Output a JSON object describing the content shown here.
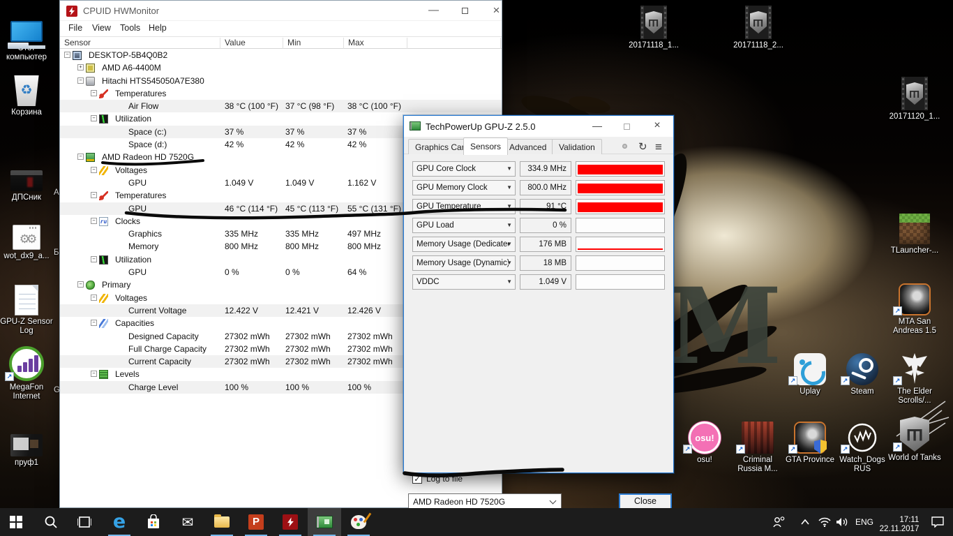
{
  "desktop_icons": [
    {
      "id": "this-pc",
      "label": "Этот компьютер"
    },
    {
      "id": "recycle-bin",
      "label": "Корзина"
    },
    {
      "id": "dpsnik",
      "label": "ДПСник"
    },
    {
      "id": "wot-dx9",
      "label": "wot_dx9_a..."
    },
    {
      "id": "gpuz-sensor-log",
      "label": "GPU-Z Sensor Log"
    },
    {
      "id": "megafon-internet",
      "label": "MegaFon Internet"
    },
    {
      "id": "pruf1",
      "label": "пруф1"
    },
    {
      "id": "replay-20171118-1",
      "label": "20171118_1..."
    },
    {
      "id": "replay-20171118-2",
      "label": "20171118_2..."
    },
    {
      "id": "replay-20171120-1",
      "label": "20171120_1..."
    },
    {
      "id": "tlauncher",
      "label": "TLauncher-..."
    },
    {
      "id": "mta-san-andreas",
      "label": "MTA San Andreas 1.5"
    },
    {
      "id": "uplay",
      "label": "Uplay"
    },
    {
      "id": "steam",
      "label": "Steam"
    },
    {
      "id": "elder-scrolls",
      "label": "The Elder Scrolls/..."
    },
    {
      "id": "osu",
      "label": "osu!"
    },
    {
      "id": "criminal-russia",
      "label": "Criminal Russia M..."
    },
    {
      "id": "gta-province",
      "label": "GTA Province"
    },
    {
      "id": "watch-dogs-rus",
      "label": "Watch_Dogs RUS"
    },
    {
      "id": "world-of-tanks",
      "label": "World of Tanks"
    }
  ],
  "hidden_label_fragments": [
    "А",
    "Б",
    "G"
  ],
  "hwmonitor": {
    "title": "CPUID HWMonitor",
    "menu": [
      "File",
      "View",
      "Tools",
      "Help"
    ],
    "columns": [
      "Sensor",
      "Value",
      "Min",
      "Max"
    ],
    "window_controls": {
      "minimize": "—",
      "close": "×"
    },
    "rows": [
      {
        "label": "DESKTOP-5B4Q0B2",
        "level": 0,
        "icon": "computer",
        "expand": "minus"
      },
      {
        "label": "AMD A6-4400M",
        "level": 1,
        "icon": "chip",
        "expand": "plus"
      },
      {
        "label": "Hitachi HTS545050A7E380",
        "level": 1,
        "icon": "disk",
        "expand": "minus"
      },
      {
        "label": "Temperatures",
        "level": 2,
        "icon": "thermo",
        "expand": "minus"
      },
      {
        "label": "Air Flow",
        "level": 3,
        "value": "38 °C  (100 °F)",
        "min": "37 °C  (98 °F)",
        "max": "38 °C  (100 °F)",
        "shaded": true
      },
      {
        "label": "Utilization",
        "level": 2,
        "icon": "util",
        "expand": "minus"
      },
      {
        "label": "Space (c:)",
        "level": 3,
        "value": "37 %",
        "min": "37 %",
        "max": "37 %",
        "shaded": true
      },
      {
        "label": "Space (d:)",
        "level": 3,
        "value": "42 %",
        "min": "42 %",
        "max": "42 %"
      },
      {
        "label": "AMD Radeon HD 7520G",
        "level": 1,
        "icon": "gpu",
        "expand": "minus"
      },
      {
        "label": "Voltages",
        "level": 2,
        "icon": "volt",
        "expand": "minus"
      },
      {
        "label": "GPU",
        "level": 3,
        "value": "1.049 V",
        "min": "1.049 V",
        "max": "1.162 V"
      },
      {
        "label": "Temperatures",
        "level": 2,
        "icon": "thermo",
        "expand": "minus"
      },
      {
        "label": "GPU",
        "level": 3,
        "value": "46 °C  (114 °F)",
        "min": "45 °C  (113 °F)",
        "max": "55 °C  (131 °F)",
        "shaded": true
      },
      {
        "label": "Clocks",
        "level": 2,
        "icon": "clock",
        "expand": "minus"
      },
      {
        "label": "Graphics",
        "level": 3,
        "value": "335 MHz",
        "min": "335 MHz",
        "max": "497 MHz"
      },
      {
        "label": "Memory",
        "level": 3,
        "value": "800 MHz",
        "min": "800 MHz",
        "max": "800 MHz"
      },
      {
        "label": "Utilization",
        "level": 2,
        "icon": "util",
        "expand": "minus"
      },
      {
        "label": "GPU",
        "level": 3,
        "value": "0 %",
        "min": "0 %",
        "max": "64 %"
      },
      {
        "label": "Primary",
        "level": 1,
        "icon": "battery",
        "expand": "minus"
      },
      {
        "label": "Voltages",
        "level": 2,
        "icon": "volt",
        "expand": "minus"
      },
      {
        "label": "Current Voltage",
        "level": 3,
        "value": "12.422 V",
        "min": "12.421 V",
        "max": "12.426 V",
        "shaded": true
      },
      {
        "label": "Capacities",
        "level": 2,
        "icon": "capacity",
        "expand": "minus"
      },
      {
        "label": "Designed Capacity",
        "level": 3,
        "value": "27302 mWh",
        "min": "27302 mWh",
        "max": "27302 mWh"
      },
      {
        "label": "Full Charge Capacity",
        "level": 3,
        "value": "27302 mWh",
        "min": "27302 mWh",
        "max": "27302 mWh"
      },
      {
        "label": "Current Capacity",
        "level": 3,
        "value": "27302 mWh",
        "min": "27302 mWh",
        "max": "27302 mWh",
        "shaded": true
      },
      {
        "label": "Levels",
        "level": 2,
        "icon": "levels",
        "expand": "minus"
      },
      {
        "label": "Charge Level",
        "level": 3,
        "value": "100 %",
        "min": "100 %",
        "max": "100 %",
        "shaded": true
      }
    ]
  },
  "gpuz": {
    "title": "TechPowerUp GPU-Z 2.5.0",
    "tabs": [
      "Graphics Card",
      "Sensors",
      "Advanced",
      "Validation"
    ],
    "active_tab": "Sensors",
    "toolbar_icons": [
      "camera-screenshot",
      "refresh",
      "menu"
    ],
    "refresh_glyph": "↻",
    "menu_glyph": "≡",
    "window_controls": {
      "minimize": "—",
      "close": "×"
    },
    "sensors": [
      {
        "label": "GPU Core Clock",
        "value": "334.9 MHz",
        "bar": 78
      },
      {
        "label": "GPU Memory Clock",
        "value": "800.0 MHz",
        "bar": 78
      },
      {
        "label": "GPU Temperature",
        "value": "91 °C",
        "bar": 78
      },
      {
        "label": "GPU Load",
        "value": "0 %",
        "bar": 0
      },
      {
        "label": "Memory Usage (Dedicated)",
        "value": "176 MB",
        "bar": 12
      },
      {
        "label": "Memory Usage (Dynamic)",
        "value": "18 MB",
        "bar": 0
      },
      {
        "label": "VDDC",
        "value": "1.049 V",
        "bar": 0
      }
    ],
    "log_to_file_label": "Log to file",
    "log_checked": "✓",
    "device_selector": "AMD Radeon HD 7520G",
    "close_button": "Close",
    "bar_color": "#ff0000",
    "border_color": "#2b7cd3"
  },
  "taskbar": {
    "buttons": [
      "start",
      "search",
      "task-view",
      "edge",
      "store",
      "mail",
      "file-explorer",
      "powerpoint",
      "hwmonitor",
      "gpu-z",
      "paint"
    ],
    "running_indicator_color": "#76b9ed",
    "tray": {
      "language": "ENG",
      "time": "17:11",
      "date": "22.11.2017"
    }
  }
}
